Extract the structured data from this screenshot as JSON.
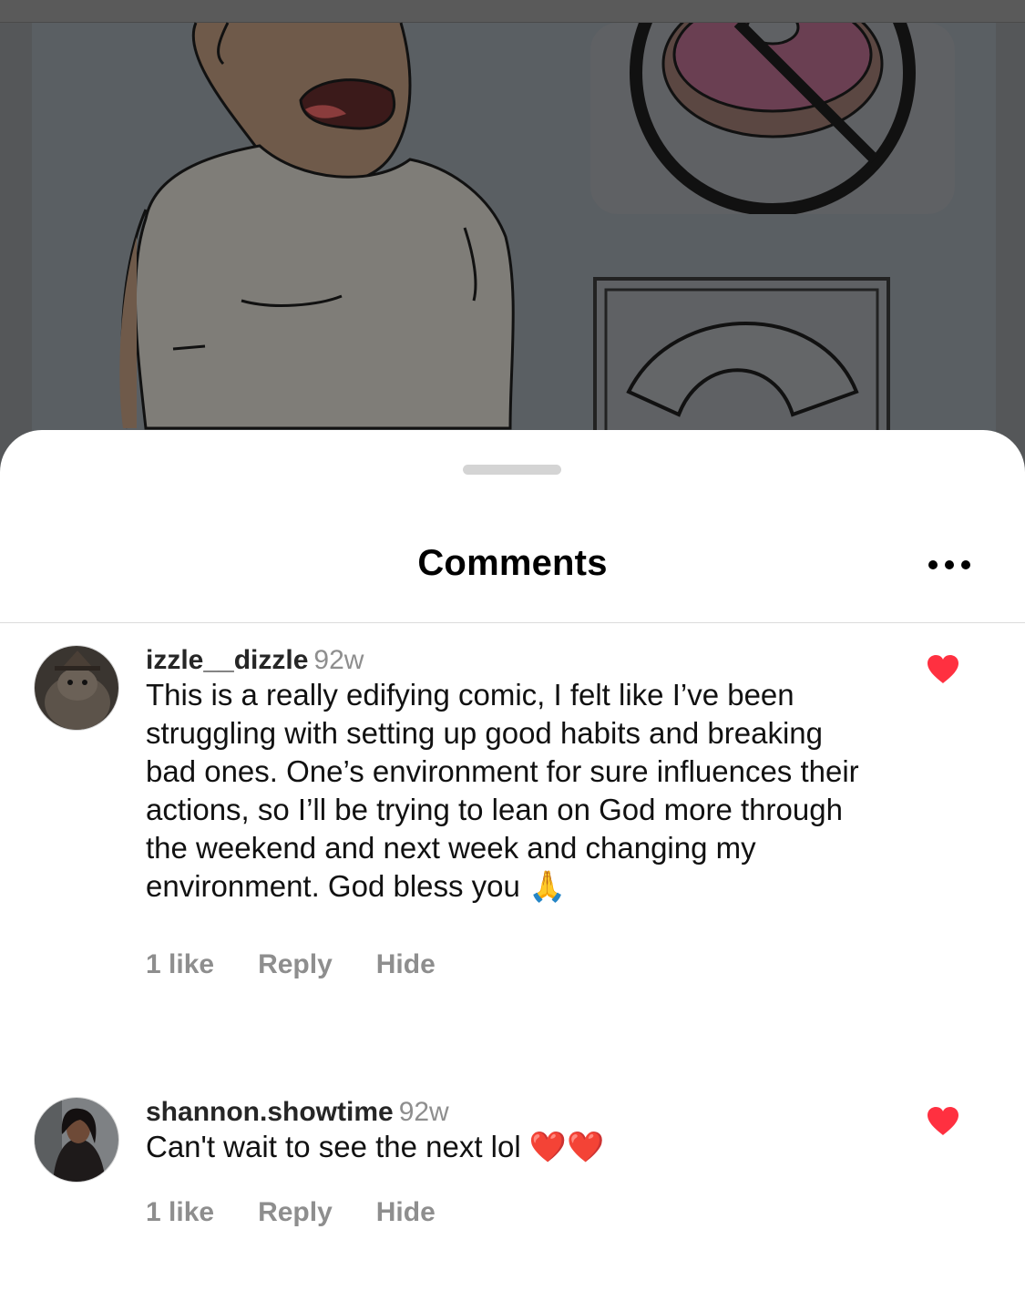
{
  "sheet": {
    "title": "Comments",
    "more_icon": "more-horizontal-icon"
  },
  "comments": [
    {
      "username": "izzle__dizzle",
      "time": "92w",
      "text": "This is a really edifying comic, I felt like I’ve been struggling with setting up good habits and breaking bad ones. One’s environment for sure influences their actions, so I’ll be trying to lean on God more through the weekend and next week and changing my environment. God bless you 🙏",
      "likes_label": "1 like",
      "reply_label": "Reply",
      "hide_label": "Hide",
      "liked": true
    },
    {
      "username": "shannon.showtime",
      "time": "92w",
      "text": "Can't wait to see the next lol ❤️❤️",
      "likes_label": "1 like",
      "reply_label": "Reply",
      "hide_label": "Hide",
      "liked": true
    }
  ],
  "colors": {
    "like_red": "#ff3040",
    "muted_text": "#8e8e8e",
    "backdrop": "#555759"
  }
}
